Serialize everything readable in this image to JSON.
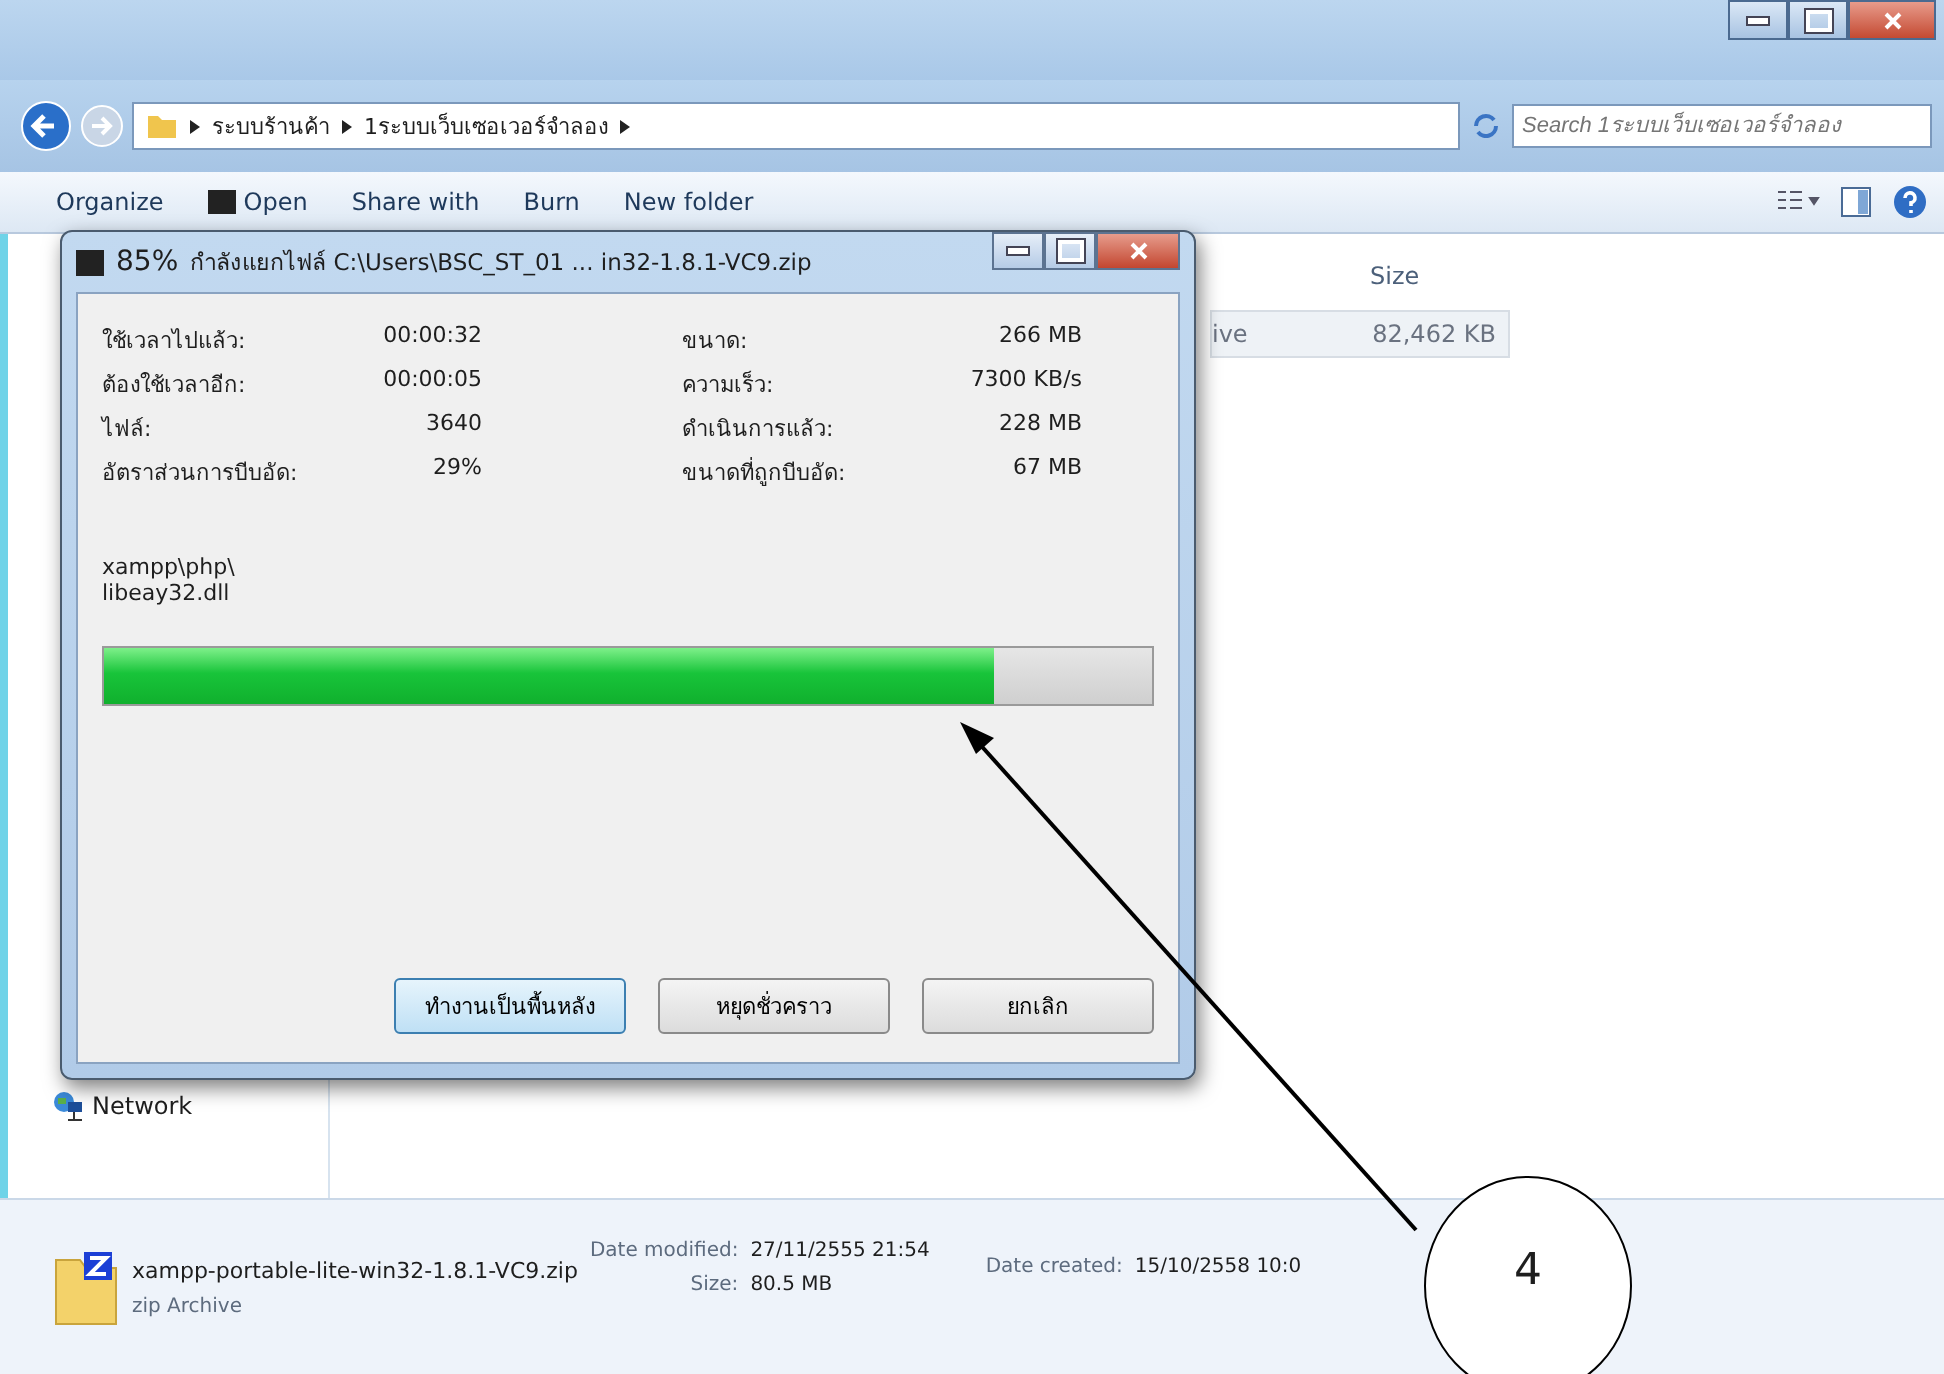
{
  "explorer": {
    "breadcrumb": [
      "ระบบร้านค้า",
      "1ระบบเว็บเซอเวอร์จำลอง"
    ],
    "search": {
      "placeholder": "Search 1ระบบเว็บเซอเวอร์จำลอง"
    },
    "toolbar": [
      "Organize",
      "Open",
      "Share with",
      "Burn",
      "New folder"
    ],
    "columns": [
      "Size"
    ],
    "rows": [
      {
        "column_1": "ive",
        "size": "82,462 KB",
        "selected": true
      }
    ],
    "nav": [
      {
        "label": "Network"
      }
    ],
    "details": {
      "name": "xampp-portable-lite-win32-1.8.1-VC9.zip",
      "type": "zip Archive",
      "fields": [
        {
          "label": "Date modified:",
          "value": "27/11/2555 21:54"
        },
        {
          "label": "Size:",
          "value": "80.5 MB"
        },
        {
          "label": "Date created:",
          "value": "15/10/2558 10:0"
        }
      ]
    }
  },
  "dialog": {
    "title_percent": "85%",
    "title": "กำลังแยกไฟล์ C:\\Users\\BSC_ST_01 ... in32-1.8.1-VC9.zip",
    "stats_left": [
      {
        "label": "ใช้เวลาไปแล้ว:",
        "value": "00:00:32"
      },
      {
        "label": "ต้องใช้เวลาอีก:",
        "value": "00:00:05"
      },
      {
        "label": "ไฟล์:",
        "value": "3640"
      },
      {
        "label": "อัตราส่วนการบีบอัด:",
        "value": "29%"
      }
    ],
    "stats_right": [
      {
        "label": "ขนาด:",
        "value": "266 MB"
      },
      {
        "label": "ความเร็ว:",
        "value": "7300 KB/s"
      },
      {
        "label": "ดำเนินการแล้ว:",
        "value": "228 MB"
      },
      {
        "label": "ขนาดที่ถูกบีบอัด:",
        "value": "67 MB"
      }
    ],
    "current_file": [
      "xampp\\php\\",
      "libeay32.dll"
    ],
    "progress": {
      "level": 0.85
    },
    "buttons": [
      {
        "label": "ทำงานเป็นพื้นหลัง",
        "selected": true
      },
      {
        "label": "หยุดชั่วคราว",
        "selected": false
      },
      {
        "label": "ยกเลิก",
        "selected": false
      }
    ]
  },
  "annotation": {
    "label": "4"
  }
}
